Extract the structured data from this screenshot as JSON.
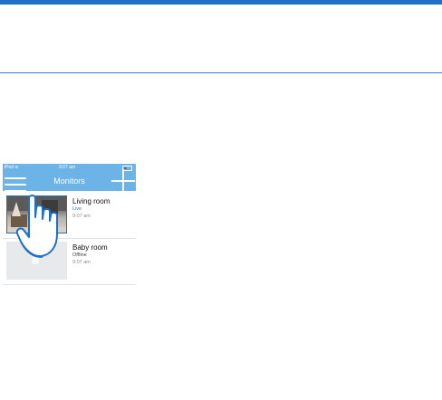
{
  "statusbar": {
    "carrier": "iPod",
    "time": "9:07 am"
  },
  "navbar": {
    "title": "Monitors"
  },
  "monitors": [
    {
      "name": "Living room",
      "status": "Live",
      "time": "9:07 am"
    },
    {
      "name": "Baby room",
      "status": "Offline",
      "time": "9:07 am"
    }
  ],
  "colors": {
    "rule": "#1f6fc6",
    "navbar": "#6cb3e8",
    "live_status": "#1f7fd4"
  },
  "icons": [
    "wifi-icon",
    "battery-icon",
    "menu-icon",
    "add-icon",
    "tap-hand-icon"
  ]
}
